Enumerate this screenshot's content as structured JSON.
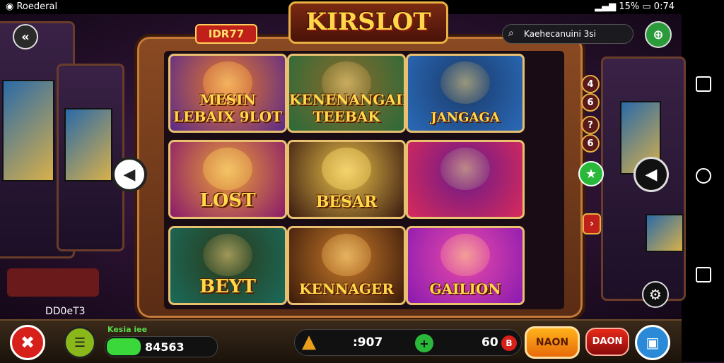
{
  "status": {
    "left": "Roederal",
    "battery": "15%",
    "time": "0:74"
  },
  "header": {
    "title": "KIRSLOT",
    "badge": "IDR77",
    "search_text": "Kaehecanuini 3si"
  },
  "tiles": [
    {
      "label": "MESIN LEBAIX 9LOT",
      "colors": [
        "#5a2a8a",
        "#e87a2a"
      ]
    },
    {
      "label": "KENENANGAIN TEEBAK",
      "colors": [
        "#2a6a3a",
        "#8a6a2a"
      ]
    },
    {
      "label": "JANGAGA",
      "colors": [
        "#2a6ab8",
        "#1a3a6a"
      ]
    },
    {
      "label": "LOST",
      "colors": [
        "#8a1a6a",
        "#e8a03a"
      ]
    },
    {
      "label": "BESAR",
      "colors": [
        "#3a1a10",
        "#e8c04a"
      ]
    },
    {
      "label": "",
      "colors": [
        "#d82a5a",
        "#6a1a8a"
      ]
    },
    {
      "label": "BEYT",
      "colors": [
        "#1a6a5a",
        "#2a3a1a"
      ]
    },
    {
      "label": "KENNAGER",
      "colors": [
        "#3a1a0a",
        "#c87a2a"
      ]
    },
    {
      "label": "GAILION",
      "colors": [
        "#8a1ab0",
        "#e84aa8"
      ]
    }
  ],
  "side_indicators": [
    "4",
    "6",
    "?",
    "6"
  ],
  "left_text": "DD0eT3",
  "bottom": {
    "credit_label": "Kesia iee",
    "credit_value": "84563",
    "center_value": ":907",
    "right_value": "60",
    "btn_main": "NAON",
    "btn_second": "DAON"
  },
  "colors": {
    "accent": "#ffd84a",
    "green": "#2ab83a",
    "red": "#d8201a"
  }
}
